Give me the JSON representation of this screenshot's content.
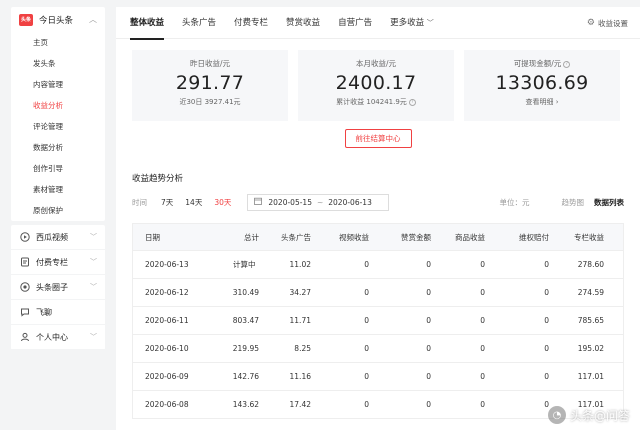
{
  "sidebar": {
    "head": {
      "logo": "头条",
      "title": "今日头条"
    },
    "items": [
      {
        "label": "主页"
      },
      {
        "label": "发头条"
      },
      {
        "label": "内容管理"
      },
      {
        "label": "收益分析"
      },
      {
        "label": "评论管理"
      },
      {
        "label": "数据分析"
      },
      {
        "label": "创作引导"
      },
      {
        "label": "素材管理"
      },
      {
        "label": "原创保护"
      }
    ],
    "groups": [
      {
        "label": "西瓜视频"
      },
      {
        "label": "付费专栏"
      },
      {
        "label": "头条圈子"
      },
      {
        "label": "飞聊"
      },
      {
        "label": "个人中心"
      }
    ]
  },
  "tabs": [
    {
      "label": "整体收益"
    },
    {
      "label": "头条广告"
    },
    {
      "label": "付费专栏"
    },
    {
      "label": "赞赏收益"
    },
    {
      "label": "自营广告"
    },
    {
      "label": "更多收益"
    }
  ],
  "settings_label": "收益设置",
  "cards": [
    {
      "label": "昨日收益/元",
      "value": "291.77",
      "sub": "近30日 3927.41元"
    },
    {
      "label": "本月收益/元",
      "value": "2400.17",
      "sub": "累计收益 104241.9元"
    },
    {
      "label": "可提现金额/元",
      "value": "13306.69",
      "sub": "查看明细 ›"
    }
  ],
  "settle_button": "前往结算中心",
  "trend": {
    "title": "收益趋势分析",
    "time_label": "时间",
    "options": [
      "7天",
      "14天",
      "30天"
    ],
    "date_from": "2020-05-15",
    "date_sep": "~",
    "date_to": "2020-06-13",
    "unit": "单位：元",
    "view_chart": "趋势图",
    "view_table": "数据列表"
  },
  "table": {
    "headers": [
      "日期",
      "总计",
      "头条广告",
      "视频收益",
      "赞赏金额",
      "商品收益",
      "维权赔付",
      "专栏收益"
    ],
    "rows": [
      [
        "2020-06-13",
        "计算中",
        "11.02",
        "0",
        "0",
        "0",
        "0",
        "278.60"
      ],
      [
        "2020-06-12",
        "310.49",
        "34.27",
        "0",
        "0",
        "0",
        "0",
        "274.59"
      ],
      [
        "2020-06-11",
        "803.47",
        "11.71",
        "0",
        "0",
        "0",
        "0",
        "785.65"
      ],
      [
        "2020-06-10",
        "219.95",
        "8.25",
        "0",
        "0",
        "0",
        "0",
        "195.02"
      ],
      [
        "2020-06-09",
        "142.76",
        "11.16",
        "0",
        "0",
        "0",
        "0",
        "117.01"
      ],
      [
        "2020-06-08",
        "143.62",
        "17.42",
        "0",
        "0",
        "0",
        "0",
        "117.01"
      ]
    ]
  },
  "watermark": "头条@问答",
  "colors": {
    "accent": "#f04142"
  }
}
